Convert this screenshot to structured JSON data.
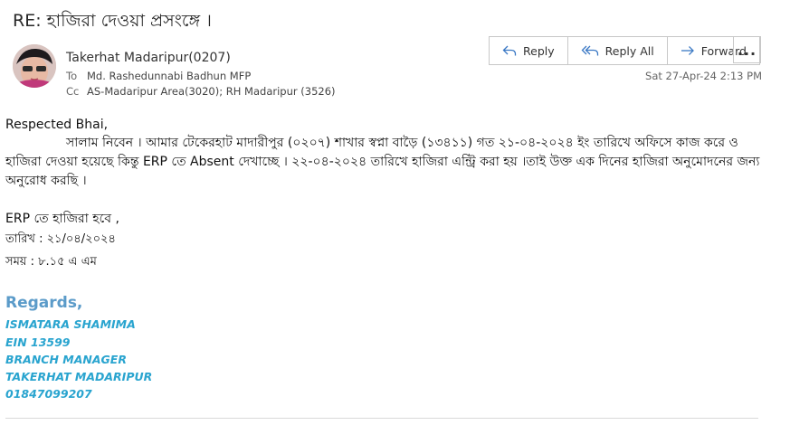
{
  "email": {
    "subject": "RE: হাজিরা দেওয়া প্রসংঙ্গে ।",
    "from": "Takerhat Madaripur(0207)",
    "to_label": "To",
    "to": "Md. Rashedunnabi Badhun MFP",
    "cc_label": "Cc",
    "cc": "AS-Madaripur Area(3020); RH Madaripur (3526)",
    "timestamp": "Sat 27-Apr-24 2:13 PM"
  },
  "toolbar": {
    "reply": "Reply",
    "reply_all": "Reply All",
    "forward": "Forward",
    "more": "..."
  },
  "body": {
    "greeting": "Respected Bhai,",
    "paragraph": "সালাম নিবেন । আমার টেকেরহাট মাদারীপুর (০২০৭) শাখার স্বপ্না বাড়ৈ (১৩৪১১)  গত ২১-০৪-২০২৪ ইং তারিখে অফিসে কাজ করে ও হাজিরা দেওয়া হয়েছে কিন্তু  ERP তে Absent  দেখাচ্ছে  । ২২-০৪-২০২৪ তারিখে হাজিরা এন্ট্রি করা হয় ।তাই উক্ত এক দিনের হাজিরা অনুমোদনের জন্য অনুরোধ করছি ।",
    "erp_line": "ERP তে হাজিরা হবে ,",
    "date_line": "তারিখ : ২১/০৪/২০২৪",
    "time_line": "সময় : ৮.১৫ এ এম"
  },
  "signature": {
    "regards": "Regards,",
    "name": "ISMATARA SHAMIMA",
    "ein": "EIN 13599",
    "title": "BRANCH MANAGER",
    "branch": "TAKERHAT MADARIPUR",
    "phone": "01847099207"
  },
  "colors": {
    "regards": "#5b9bc9",
    "signature": "#29a4cf",
    "icon_accent": "#3a78c4"
  }
}
